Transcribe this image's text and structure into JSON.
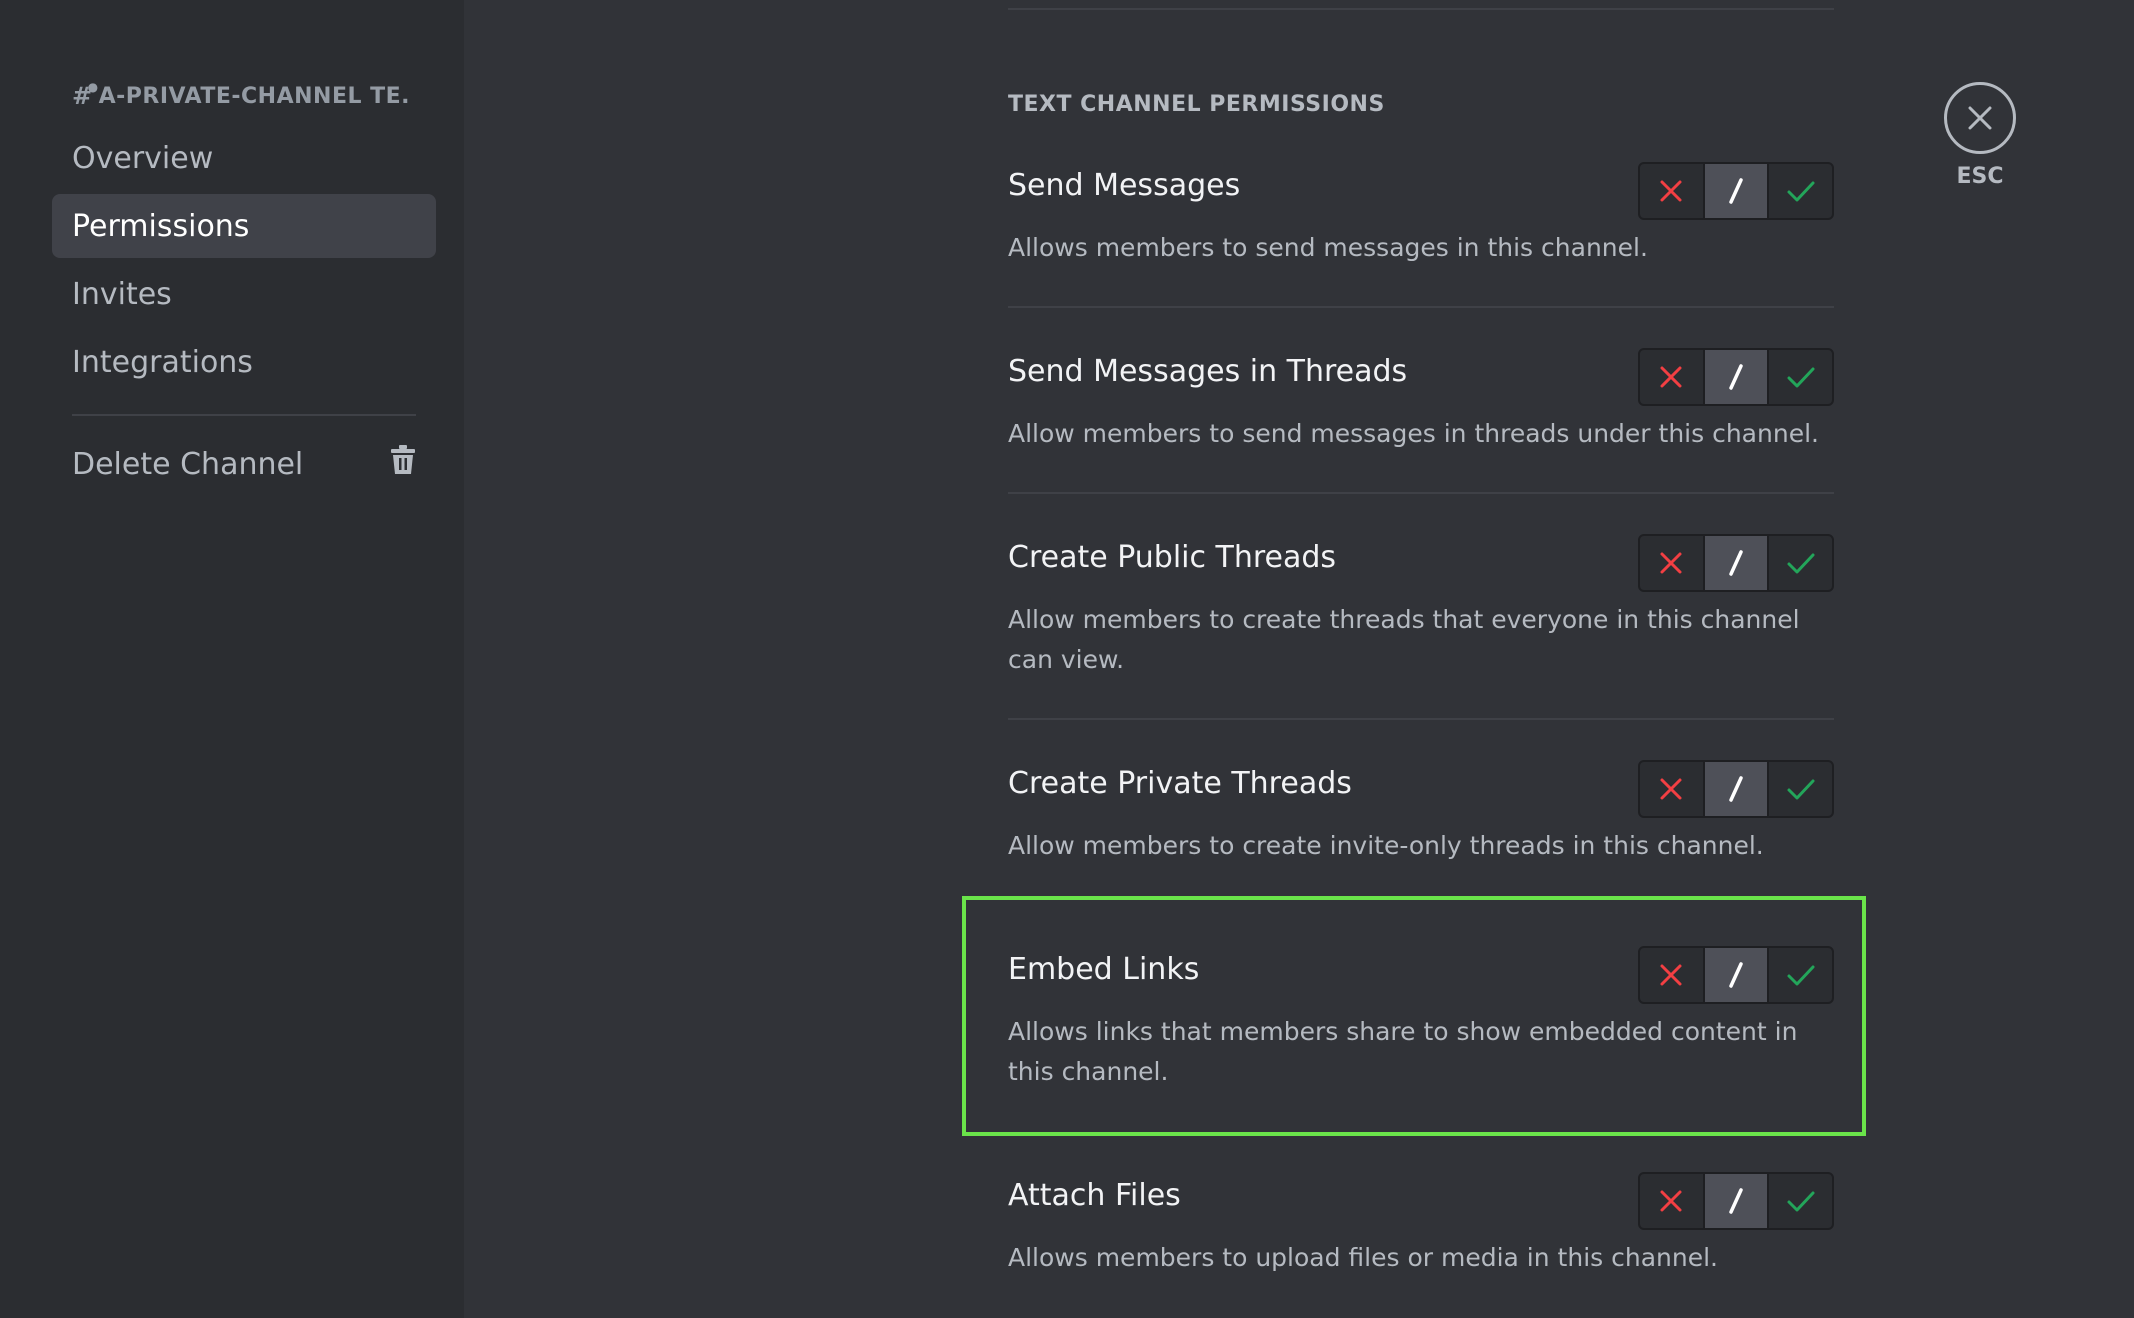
{
  "sidebar": {
    "channel_header": "A-PRIVATE-CHANNEL TE...",
    "items": [
      {
        "label": "Overview"
      },
      {
        "label": "Permissions"
      },
      {
        "label": "Invites"
      },
      {
        "label": "Integrations"
      }
    ],
    "delete_label": "Delete Channel"
  },
  "section": {
    "title": "TEXT CHANNEL PERMISSIONS"
  },
  "permissions": [
    {
      "name": "Send Messages",
      "description": "Allows members to send messages in this channel."
    },
    {
      "name": "Send Messages in Threads",
      "description": "Allow members to send messages in threads under this channel."
    },
    {
      "name": "Create Public Threads",
      "description": "Allow members to create threads that everyone in this channel can view."
    },
    {
      "name": "Create Private Threads",
      "description": "Allow members to create invite-only threads in this channel."
    },
    {
      "name": "Embed Links",
      "description": "Allows links that members share to show embedded content in this channel."
    },
    {
      "name": "Attach Files",
      "description": "Allows members to upload files or media in this channel."
    }
  ],
  "toggle_state": "neutral",
  "close": {
    "label": "ESC"
  },
  "colors": {
    "deny": "#f23f43",
    "allow": "#23a55a",
    "highlight": "#6ae44a",
    "background": "#313338",
    "sidebar": "#2b2d31"
  }
}
